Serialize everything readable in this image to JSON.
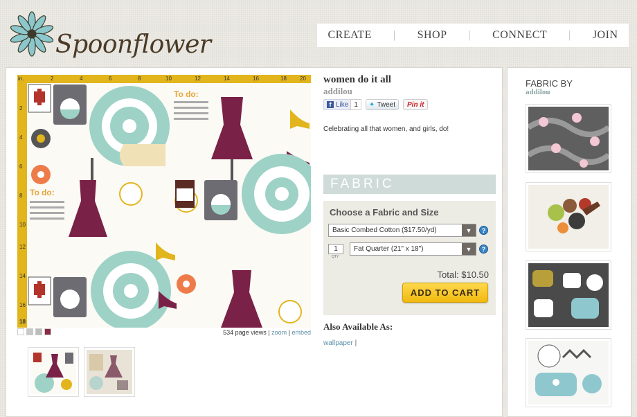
{
  "brand": {
    "name": "Spoonflower"
  },
  "nav": {
    "items": [
      "CREATE",
      "SHOP",
      "CONNECT",
      "JOIN"
    ],
    "separator": "|"
  },
  "design": {
    "title": "women do it all",
    "designer": "addilou",
    "description": "Celebrating all that women, and girls, do!",
    "ruler_top_unit": "in.",
    "ruler_top": [
      "2",
      "4",
      "6",
      "8",
      "10",
      "12",
      "14",
      "16",
      "18",
      "20"
    ],
    "ruler_left": [
      "2",
      "4",
      "6",
      "8",
      "10",
      "12",
      "14",
      "16",
      "18"
    ],
    "pattern_text": "To do:",
    "page_views": "534 page views",
    "views_sep": "|",
    "zoom_link": "zoom",
    "embed_link": "embed",
    "swatch_colors": [
      "#ffffff",
      "#c8c8c8",
      "#bcbcbc",
      "#8b2a45"
    ]
  },
  "social": {
    "facebook_label": "Like",
    "facebook_count": "1",
    "twitter_label": "Tweet",
    "pinterest_label": "Pin it"
  },
  "purchase": {
    "section_heading": "FABRIC",
    "choose_title": "Choose a Fabric and Size",
    "fabric_selected": "Basic Combed Cotton ($17.50/yd)",
    "quantity": "1",
    "quantity_label": "QTY",
    "size_selected": "Fat Quarter (21\" x 18\")",
    "help_symbol": "?",
    "total": "Total: $10.50",
    "add_to_cart": "ADD TO CART"
  },
  "also": {
    "heading": "Also Available As:",
    "link": "wallpaper",
    "separator": "|"
  },
  "sidebar": {
    "title": "FABRIC BY",
    "designer": "addilou"
  },
  "colors": {
    "accent_teal": "#9ed2c6",
    "plum": "#7a2147",
    "mustard": "#e2b51d",
    "cart_yellow": "#f5c518"
  }
}
